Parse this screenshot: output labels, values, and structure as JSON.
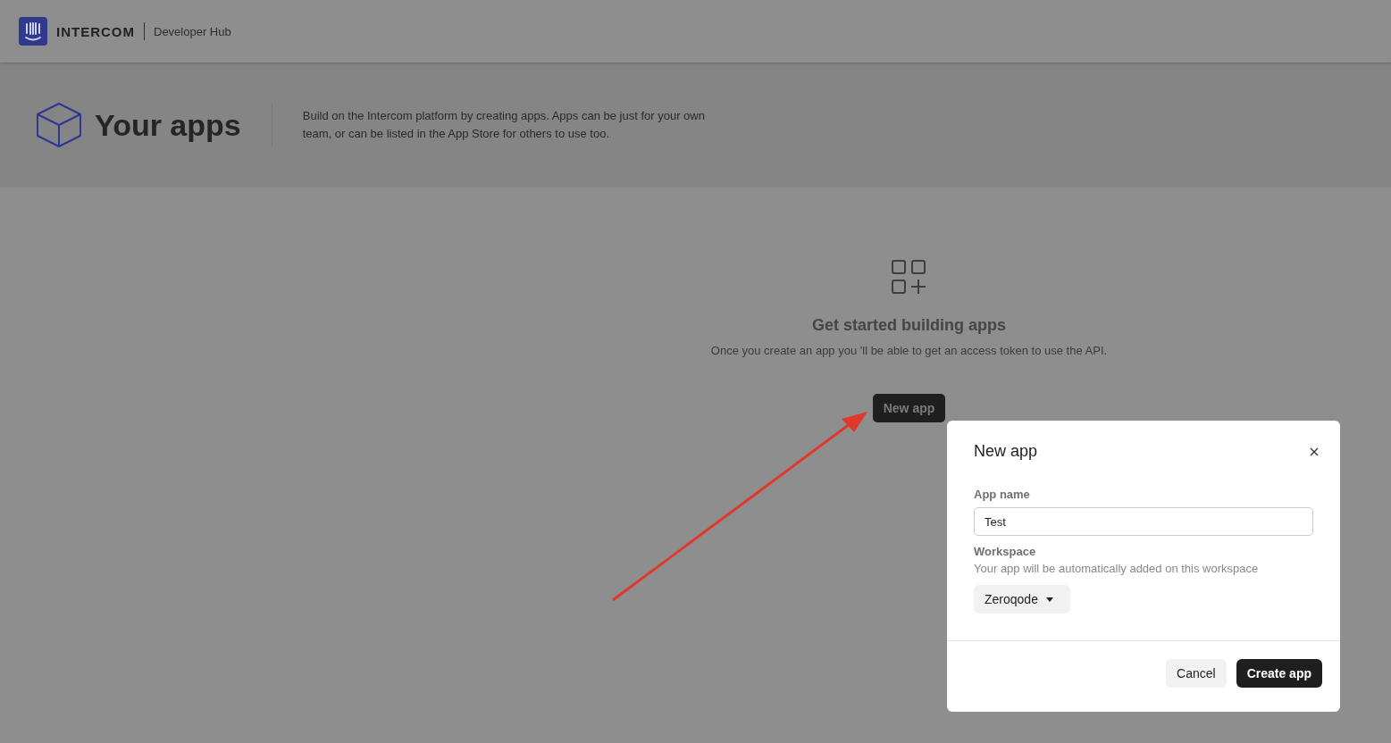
{
  "header": {
    "brand": "INTERCOM",
    "section": "Developer Hub"
  },
  "hero": {
    "title": "Your apps",
    "description": "Build on the Intercom platform by creating apps. Apps can be just for your own team, or can be listed in the App Store for others to use too."
  },
  "empty_state": {
    "heading": "Get started building apps",
    "message": "Once you create an app you 'll be able to get an access token to use the API.",
    "button": "New app"
  },
  "dialog": {
    "title": "New app",
    "fields": [
      {
        "kind": "text",
        "label": "App name",
        "value": "Test"
      },
      {
        "kind": "select",
        "label": "Workspace",
        "help": "Your app will be automatically added on this workspace",
        "value": "Zeroqode"
      }
    ],
    "buttons": [
      {
        "label": "Cancel",
        "primary": false
      },
      {
        "label": "Create app",
        "primary": true
      }
    ]
  }
}
